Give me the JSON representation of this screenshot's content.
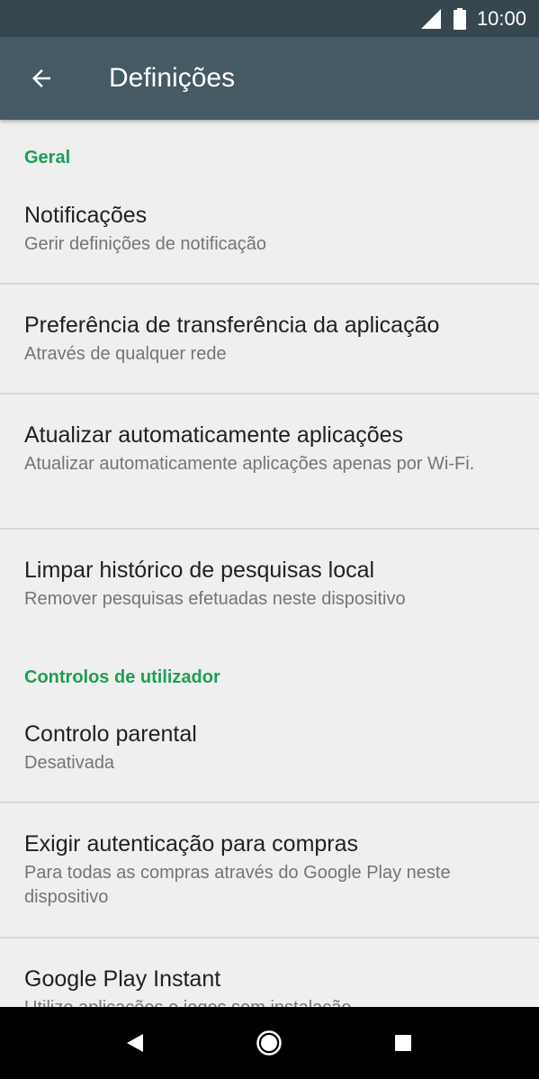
{
  "status_bar": {
    "time": "10:00",
    "icons": [
      "signal-icon",
      "battery-icon"
    ]
  },
  "app_bar": {
    "back_icon": "arrow-back-icon",
    "title": "Definições"
  },
  "sections": [
    {
      "header": "Geral",
      "items": [
        {
          "title": "Notificações",
          "summary": "Gerir definições de notificação"
        },
        {
          "title": "Preferência de transferência da aplicação",
          "summary": "Através de qualquer rede"
        },
        {
          "title": "Atualizar automaticamente aplicações",
          "summary": "Atualizar automaticamente aplicações apenas por Wi-Fi."
        },
        {
          "title": "Limpar histórico de pesquisas local",
          "summary": "Remover pesquisas efetuadas neste dispositivo"
        }
      ]
    },
    {
      "header": "Controlos de utilizador",
      "items": [
        {
          "title": "Controlo parental",
          "summary": "Desativada"
        },
        {
          "title": "Exigir autenticação para compras",
          "summary": "Para todas as compras através do Google Play neste dispositivo"
        },
        {
          "title": "Google Play Instant",
          "summary": "Utilize aplicações e jogos sem instalação"
        }
      ]
    }
  ],
  "nav_bar": {
    "icons": [
      "back-triangle-icon",
      "home-circle-icon",
      "recents-square-icon"
    ]
  },
  "colors": {
    "status_bar": "#37474f",
    "app_bar": "#455a64",
    "accent": "#1e9e57",
    "background": "#efefef"
  }
}
